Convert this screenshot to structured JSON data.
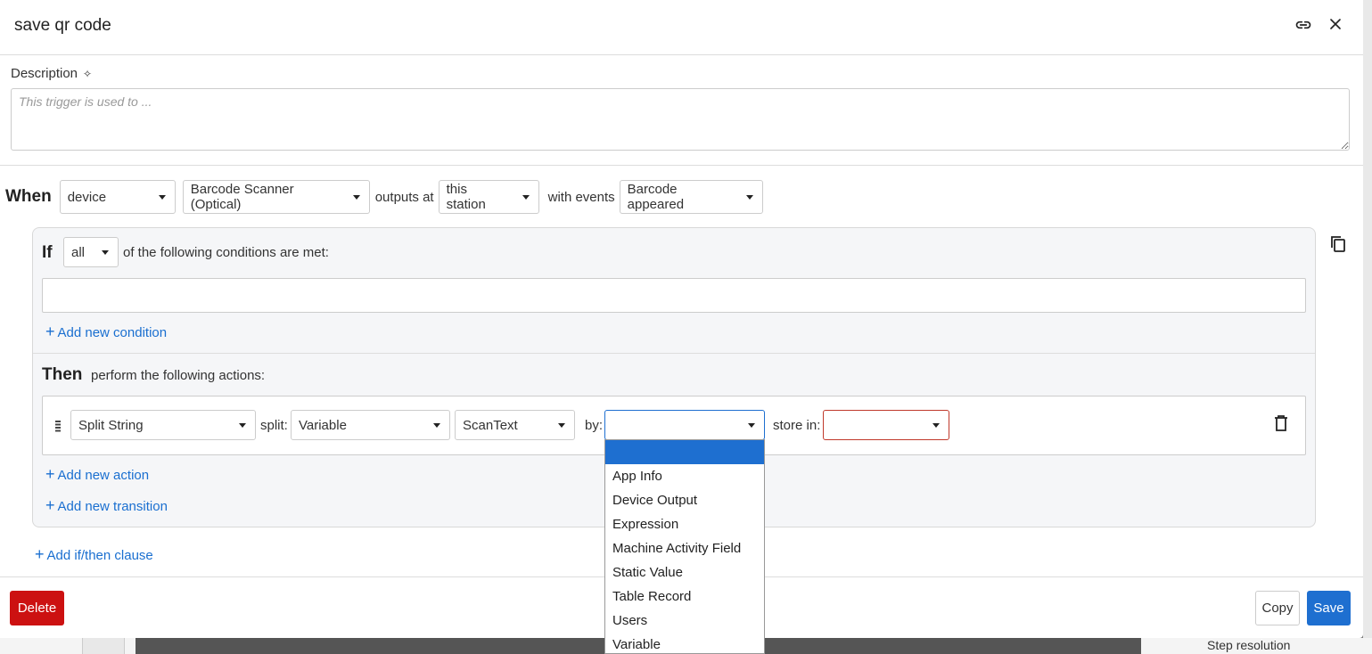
{
  "dialog": {
    "title": "save qr code",
    "description_label": "Description",
    "description_placeholder": "This trigger is used to ..."
  },
  "when": {
    "keyword": "When",
    "source": "device",
    "device": "Barcode Scanner (Optical)",
    "outputs_at_text": "outputs at",
    "station": "this station",
    "with_events_text": "with events",
    "event": "Barcode appeared"
  },
  "if_block": {
    "keyword": "If",
    "mode": "all",
    "text": "of the following conditions are met:",
    "add_condition": "Add new condition"
  },
  "then_block": {
    "keyword": "Then",
    "text": "perform the following actions:",
    "action": {
      "type": "Split String",
      "split_label": "split:",
      "split_source": "Variable",
      "split_value": "ScanText",
      "by_label": "by:",
      "by_value": "",
      "store_label": "store in:",
      "store_value": ""
    },
    "add_action": "Add new action",
    "add_transition": "Add new transition"
  },
  "add_clause": "Add if/then clause",
  "by_dropdown_options": [
    "",
    "App Info",
    "Device Output",
    "Expression",
    "Machine Activity Field",
    "Static Value",
    "Table Record",
    "Users",
    "Variable"
  ],
  "footer": {
    "delete": "Delete",
    "copy": "Copy",
    "save": "Save"
  },
  "background": {
    "step_resolution": "Step resolution"
  },
  "colors": {
    "accent": "#1e6fd0",
    "danger": "#cc1111",
    "error_border": "#c0392b"
  }
}
